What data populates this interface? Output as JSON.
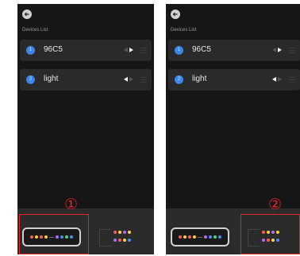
{
  "screens": [
    {
      "header": {
        "title": "Devices List"
      },
      "devices": [
        {
          "badge": "1",
          "name": "96C5",
          "left_on": false,
          "right_on": true
        },
        {
          "badge": "2",
          "name": "light",
          "left_on": true,
          "right_on": false
        }
      ],
      "marker": "①"
    },
    {
      "header": {
        "title": "Devices List"
      },
      "devices": [
        {
          "badge": "1",
          "name": "96C5",
          "left_on": false,
          "right_on": true
        },
        {
          "badge": "2",
          "name": "light",
          "left_on": true,
          "right_on": false
        }
      ],
      "marker": "②"
    }
  ],
  "colors": {
    "accent_blue": "#3d87ea",
    "annotation_red": "#e0252b",
    "led_red": "#ff5a5a",
    "led_yellow": "#ffd23c",
    "led_purple": "#b06cff",
    "led_blue": "#4a8cff",
    "led_green": "#59d36b"
  }
}
